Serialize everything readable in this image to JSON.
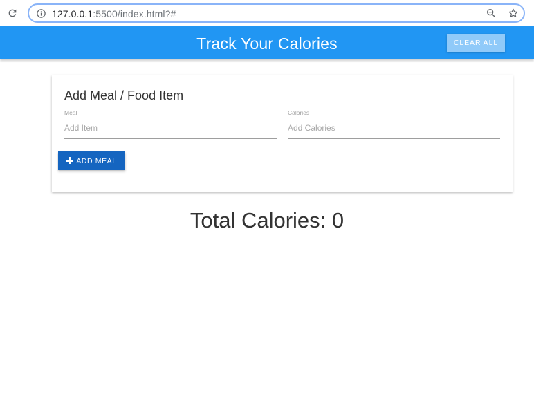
{
  "browser": {
    "url_host": "127.0.0.1",
    "url_rest": ":5500/index.html?#",
    "icons": [
      "reload-icon",
      "info-icon",
      "zoom-icon",
      "star-icon"
    ]
  },
  "nav": {
    "title": "Track Your Calories",
    "clear_label": "Clear All",
    "color": "#2196f3"
  },
  "form": {
    "title": "Add Meal / Food Item",
    "meal": {
      "label": "Meal",
      "placeholder": "Add Item",
      "value": ""
    },
    "calories": {
      "label": "Calories",
      "placeholder": "Add Calories",
      "value": ""
    },
    "add_label": "Add Meal",
    "add_color": "#1565c0"
  },
  "total": {
    "label": "Total Calories:",
    "value": "0"
  }
}
